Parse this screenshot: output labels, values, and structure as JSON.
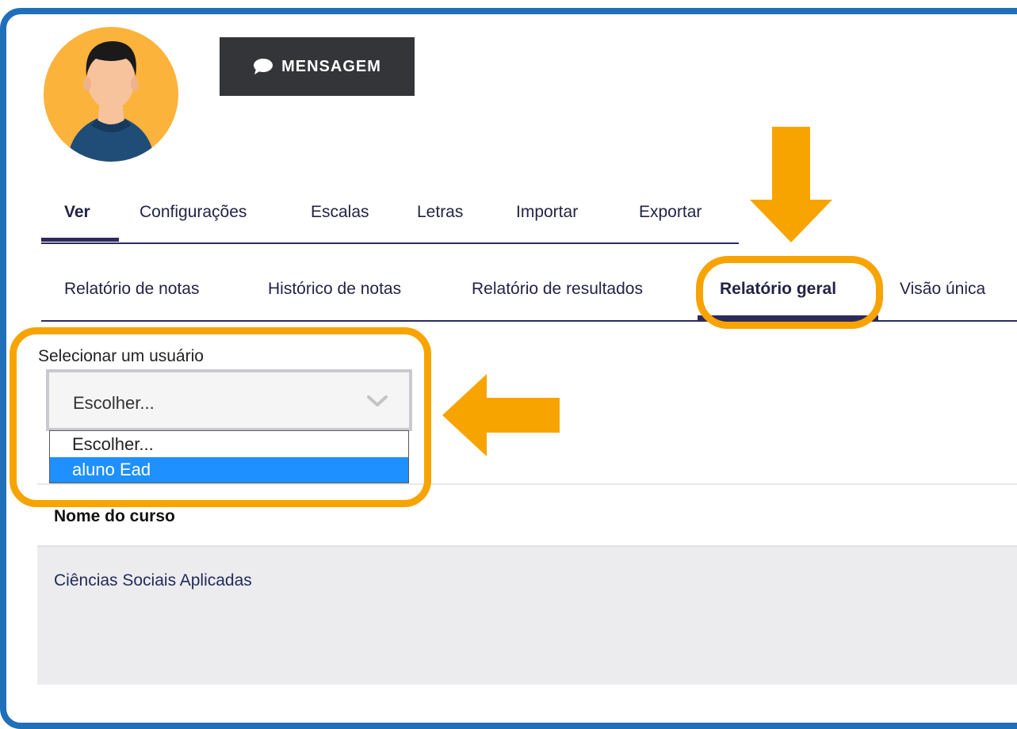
{
  "profile": {
    "message_button_label": "MENSAGEM",
    "message_icon": "speech-bubble-icon"
  },
  "primary_tabs": [
    {
      "label": "Ver",
      "active": true
    },
    {
      "label": "Configurações"
    },
    {
      "label": "Escalas"
    },
    {
      "label": "Letras"
    },
    {
      "label": "Importar"
    },
    {
      "label": "Exportar"
    }
  ],
  "report_tabs": [
    {
      "label": "Relatório de notas"
    },
    {
      "label": "Histórico de notas"
    },
    {
      "label": "Relatório de resultados"
    },
    {
      "label": "Relatório geral",
      "active": true
    },
    {
      "label": "Visão única"
    }
  ],
  "user_select": {
    "label": "Selecionar um usuário",
    "value": "Escolher...",
    "options": [
      "Escolher...",
      "aluno Ead"
    ],
    "highlighted_option": "aluno Ead"
  },
  "table": {
    "column_header": "Nome do curso",
    "rows": [
      {
        "course_name": "Ciências Sociais Aplicadas"
      }
    ]
  },
  "colors": {
    "frame_border": "#1f6fba",
    "annotation": "#f7a400",
    "option_highlight": "#1e90ff",
    "dark_button": "#333538"
  }
}
